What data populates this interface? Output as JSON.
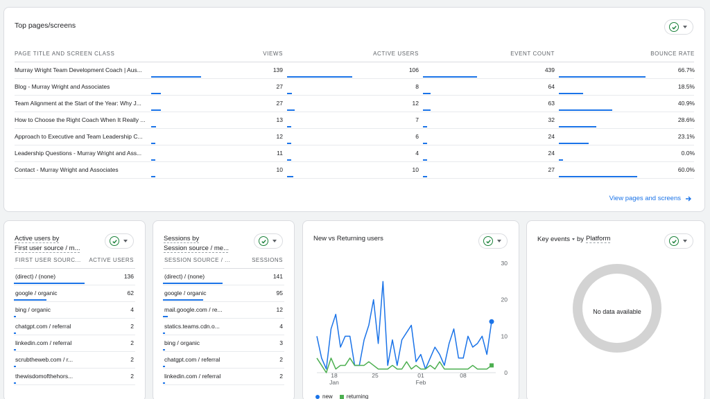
{
  "top_pages": {
    "title": "Top pages/screens",
    "columns": [
      "PAGE TITLE AND SCREEN CLASS",
      "VIEWS",
      "ACTIVE USERS",
      "EVENT COUNT",
      "BOUNCE RATE"
    ],
    "rows": [
      {
        "title": "Murray Wright Team Development Coach | Aus...",
        "views": "139",
        "active_users": "106",
        "event_count": "439",
        "bounce_rate": "66.7%"
      },
      {
        "title": "Blog - Murray Wright and Associates",
        "views": "27",
        "active_users": "8",
        "event_count": "64",
        "bounce_rate": "18.5%"
      },
      {
        "title": "Team Alignment at the Start of the Year: Why J...",
        "views": "27",
        "active_users": "12",
        "event_count": "63",
        "bounce_rate": "40.9%"
      },
      {
        "title": "How to Choose the Right Coach When It Really ...",
        "views": "13",
        "active_users": "7",
        "event_count": "32",
        "bounce_rate": "28.6%"
      },
      {
        "title": "Approach to Executive and Team Leadership C...",
        "views": "12",
        "active_users": "6",
        "event_count": "24",
        "bounce_rate": "23.1%"
      },
      {
        "title": "Leadership Questions - Murray Wright and Ass...",
        "views": "11",
        "active_users": "4",
        "event_count": "24",
        "bounce_rate": "0.0%"
      },
      {
        "title": "Contact - Murray Wright and Associates",
        "views": "10",
        "active_users": "10",
        "event_count": "27",
        "bounce_rate": "60.0%"
      }
    ],
    "view_link": "View pages and screens"
  },
  "active_users_card": {
    "title_line1": "Active users by",
    "title_line2": "First user source / m...",
    "col1": "FIRST USER SOURC...",
    "col2": "ACTIVE USERS",
    "rows": [
      {
        "label": "(direct) / (none)",
        "value": "136"
      },
      {
        "label": "google / organic",
        "value": "62"
      },
      {
        "label": "bing / organic",
        "value": "4"
      },
      {
        "label": "chatgpt.com / referral",
        "value": "2"
      },
      {
        "label": "linkedin.com / referral",
        "value": "2"
      },
      {
        "label": "scrubtheweb.com / r...",
        "value": "2"
      },
      {
        "label": "thewisdomofthehors...",
        "value": "2"
      }
    ]
  },
  "sessions_card": {
    "title_line1": "Sessions by",
    "title_line2": "Session source / me...",
    "col1": "SESSION SOURCE / ...",
    "col2": "SESSIONS",
    "rows": [
      {
        "label": "(direct) / (none)",
        "value": "141"
      },
      {
        "label": "google / organic",
        "value": "95"
      },
      {
        "label": "mail.google.com / re...",
        "value": "12"
      },
      {
        "label": "statics.teams.cdn.o...",
        "value": "4"
      },
      {
        "label": "bing / organic",
        "value": "3"
      },
      {
        "label": "chatgpt.com / referral",
        "value": "2"
      },
      {
        "label": "linkedin.com / referral",
        "value": "2"
      }
    ]
  },
  "new_returning": {
    "title": "New vs Returning users",
    "y_ticks": [
      "30",
      "20",
      "10",
      "0"
    ],
    "x_ticks": [
      {
        "top": "18",
        "bottom": "Jan"
      },
      {
        "top": "25",
        "bottom": ""
      },
      {
        "top": "01",
        "bottom": "Feb"
      },
      {
        "top": "08",
        "bottom": ""
      }
    ],
    "legend_new": "new",
    "legend_returning": "returning"
  },
  "key_events": {
    "title_part1": "Key events",
    "title_part2": "by",
    "title_part3": "Platform",
    "empty_text": "No data available"
  },
  "chart_data": {
    "type": "line",
    "title": "New vs Returning users",
    "x": [
      1,
      2,
      3,
      4,
      5,
      6,
      7,
      8,
      9,
      10,
      11,
      12,
      13,
      14,
      15,
      16,
      17,
      18,
      19,
      20,
      21,
      22,
      23,
      24,
      25,
      26,
      27,
      28,
      29,
      30,
      31,
      32,
      33,
      34,
      35
    ],
    "x_ticks": [
      "18 Jan",
      "25",
      "01 Feb",
      "08"
    ],
    "ylim": [
      0,
      30
    ],
    "series": [
      {
        "name": "new",
        "color": "#1a73e8",
        "values": [
          10,
          4,
          1,
          12,
          16,
          7,
          10,
          10,
          2,
          2,
          9,
          13,
          20,
          8,
          25,
          2,
          9,
          2,
          9,
          11,
          13,
          3,
          5,
          1,
          4,
          7,
          5,
          2,
          8,
          12,
          4,
          4,
          10,
          7,
          8,
          10,
          5,
          14
        ]
      },
      {
        "name": "returning",
        "color": "#34a853",
        "values": [
          4,
          2,
          0,
          4,
          1,
          2,
          2,
          4,
          2,
          2,
          2,
          3,
          2,
          1,
          1,
          1,
          2,
          1,
          1,
          3,
          1,
          2,
          1,
          1,
          2,
          1,
          3,
          1,
          1,
          1,
          1,
          1,
          1,
          2,
          1,
          1,
          1,
          2
        ]
      }
    ]
  },
  "colors": {
    "accent": "#1a73e8",
    "returning": "#4caf50",
    "check": "#188038"
  }
}
